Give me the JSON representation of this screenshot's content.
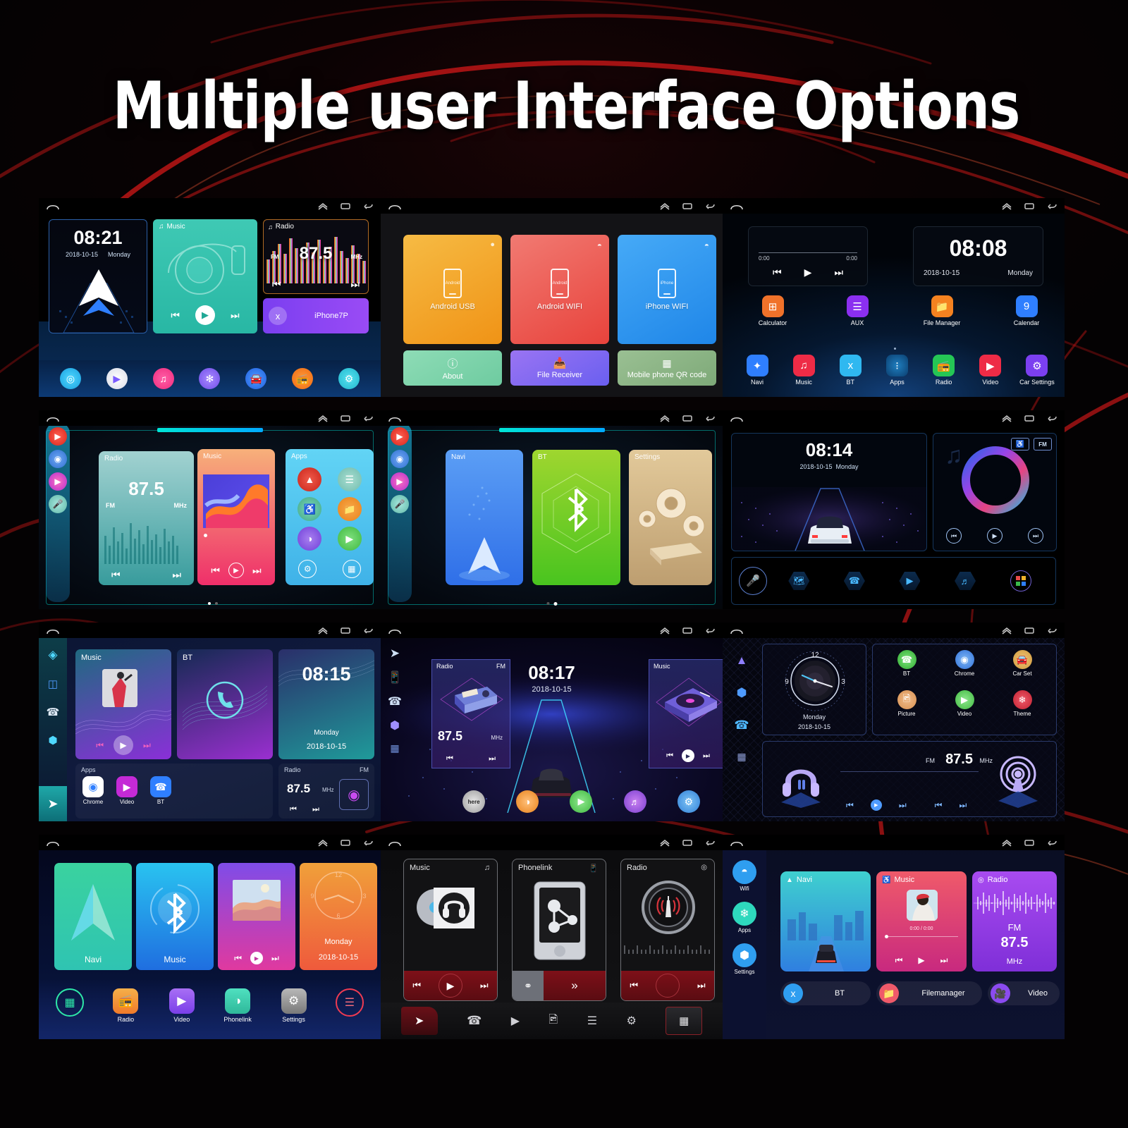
{
  "page": {
    "title": "Multiple user Interface Options"
  },
  "statusbar": {
    "home_icon": "home-icon",
    "up_icon": "chevron-up-icon",
    "recents_icon": "recents-icon",
    "back_icon": "back-icon"
  },
  "common": {
    "date": "2018-10-15",
    "day": "Monday",
    "fm": "FM",
    "mhz": "MHz",
    "freq": "87.5",
    "prev": "⏮",
    "play": "▶",
    "next": "⏭"
  },
  "screens": [
    {
      "id": "screen-1-ui-classic-cards",
      "clock": "08:21",
      "date": "2018-10-15",
      "day": "Monday",
      "music_title": "Music",
      "radio_title": "Radio",
      "radio_freq": "87.5",
      "radio_fm": "FM",
      "radio_mhz": "MHz",
      "bt_device": "iPhone7P",
      "dock": [
        {
          "label": "Navi",
          "icon": "location-pin-icon",
          "color": "#2ec6f0"
        },
        {
          "label": "Video",
          "icon": "play-icon",
          "color": "#e9eef5"
        },
        {
          "label": "Music",
          "icon": "music-note-icon",
          "color": "#ff3a8c"
        },
        {
          "label": "Theme",
          "icon": "sun-burst-icon",
          "color": "#7b5bff"
        },
        {
          "label": "Car Set",
          "icon": "car-icon",
          "color": "#2f7fff"
        },
        {
          "label": "Radio",
          "icon": "radio-icon",
          "color": "#ff7a1a"
        },
        {
          "label": "Settings",
          "icon": "gear-icon",
          "color": "#33d1e0"
        }
      ]
    },
    {
      "id": "screen-2-phonelink",
      "tiles": [
        {
          "label": "Android USB",
          "icon": "android-phone-icon",
          "badge": "usb-icon",
          "color": "#f6b73c",
          "color2": "#f59a22",
          "inner": "Android"
        },
        {
          "label": "Android WIFI",
          "icon": "android-phone-icon",
          "badge": "wifi-icon",
          "color": "#f06a6a",
          "color2": "#e8413e",
          "inner": "Android"
        },
        {
          "label": "iPhone WIFI",
          "icon": "iphone-icon",
          "badge": "wifi-icon",
          "color": "#42a5f5",
          "color2": "#1e88e5",
          "inner": "iPhone"
        }
      ],
      "tiles2": [
        {
          "label": "About",
          "icon": "info-icon",
          "color": "#7fd6ae",
          "color2": "#6fcfa6"
        },
        {
          "label": "File Receiver",
          "icon": "inbox-download-icon",
          "color": "#8f6bf0",
          "color2": "#6f63ef"
        },
        {
          "label": "Mobile phone QR code",
          "icon": "qr-code-icon",
          "color": "#8fb58a",
          "color2": "#7ea978"
        }
      ]
    },
    {
      "id": "screen-3-stock-android",
      "clock": "08:08",
      "date": "2018-10-15",
      "day": "Monday",
      "elapsed": "0:00",
      "duration": "0:00",
      "apps_row1": [
        {
          "label": "Calculator",
          "icon": "calculator-icon",
          "color": "#f0722a"
        },
        {
          "label": "AUX",
          "icon": "equalizer-icon",
          "color": "#8b2ff0"
        },
        {
          "label": "File Manager",
          "icon": "folder-icon",
          "color": "#f58220"
        },
        {
          "label": "Calendar",
          "icon": "calendar-icon",
          "color": "#2f7fff"
        }
      ],
      "apps_row2": [
        {
          "label": "Navi",
          "icon": "compass-icon",
          "color": "#2f7fff"
        },
        {
          "label": "Music",
          "icon": "music-note-icon",
          "color": "#ee2b46"
        },
        {
          "label": "BT",
          "icon": "bluetooth-icon",
          "color": "#2fb8f0"
        },
        {
          "label": "Apps",
          "icon": "app-grid-icon",
          "color": "#0e6fb0"
        },
        {
          "label": "Radio",
          "icon": "radio-icon",
          "color": "#25c655"
        },
        {
          "label": "Video",
          "icon": "play-circle-icon",
          "color": "#ee2b46"
        },
        {
          "label": "Car Settings",
          "icon": "gear-icon",
          "color": "#7b3ff0"
        }
      ]
    },
    {
      "id": "screen-4-hud-cards-a",
      "cards": [
        {
          "title": "Radio",
          "kind": "radio",
          "freq": "87.5",
          "fm": "FM",
          "mhz": "MHz"
        },
        {
          "title": "Music",
          "kind": "music"
        },
        {
          "title": "Apps",
          "kind": "apps"
        }
      ],
      "rail": [
        {
          "icon": "youtube-icon",
          "color": "#ff3b30"
        },
        {
          "icon": "chrome-icon",
          "color": "#4285f4"
        },
        {
          "icon": "play-store-icon",
          "color": "#e91e8c"
        },
        {
          "icon": "microphone-icon",
          "color": "#7ed0c0"
        }
      ],
      "app_icons": [
        {
          "icon": "navi-icon",
          "color": "#e13b3b"
        },
        {
          "icon": "equalizer-icon",
          "color": "#7fc4b8"
        },
        {
          "icon": "headset-icon",
          "color": "#63c6a8"
        },
        {
          "icon": "folder-icon",
          "color": "#f0922a"
        },
        {
          "icon": "browser-icon",
          "color": "#8b5bd6"
        },
        {
          "icon": "video-icon",
          "color": "#54c45a"
        },
        {
          "icon": "gear-icon",
          "color": "#ffffff"
        },
        {
          "icon": "app-grid-icon",
          "color": "#ffffff"
        }
      ]
    },
    {
      "id": "screen-5-hud-cards-b",
      "cards": [
        {
          "title": "Navi",
          "kind": "navi"
        },
        {
          "title": "BT",
          "kind": "bt"
        },
        {
          "title": "Settings",
          "kind": "settings"
        }
      ],
      "rail": [
        {
          "icon": "youtube-icon",
          "color": "#ff3b30"
        },
        {
          "icon": "chrome-icon",
          "color": "#4285f4"
        },
        {
          "icon": "play-store-icon",
          "color": "#e91e8c"
        },
        {
          "icon": "microphone-icon",
          "color": "#7ed0c0"
        }
      ]
    },
    {
      "id": "screen-6-car-dashboard",
      "clock": "08:14",
      "date": "2018-10-15",
      "day": "Monday",
      "fm_badge": "FM",
      "headset_badge": "headset-icon",
      "dock": [
        {
          "icon": "microphone-icon",
          "label": "Voice"
        },
        {
          "icon": "map-icon",
          "label": "Map"
        },
        {
          "icon": "phone-bt-icon",
          "label": "BT Phone"
        },
        {
          "icon": "video-icon",
          "label": "Video"
        },
        {
          "icon": "music-disc-icon",
          "label": "Music"
        },
        {
          "icon": "app-grid-icon",
          "label": "Apps"
        }
      ]
    },
    {
      "id": "screen-7-teal-cards",
      "music_title": "Music",
      "bt_title": "BT",
      "clock": "08:15",
      "day": "Monday",
      "date": "2018-10-15",
      "apps_title": "Apps",
      "apps": [
        {
          "label": "Chrome",
          "icon": "chrome-icon",
          "color": "#ffffff"
        },
        {
          "label": "Video",
          "icon": "video-icon",
          "color": "#c42ad6"
        },
        {
          "label": "BT",
          "icon": "phone-bt-icon",
          "color": "#2f7fff"
        }
      ],
      "radio_title": "Radio",
      "radio_fm": "FM",
      "radio_freq": "87.5",
      "radio_mhz": "MHz",
      "rail": [
        {
          "icon": "cube-3d-icon"
        },
        {
          "icon": "screen-cast-icon"
        },
        {
          "icon": "phone-bt-icon"
        },
        {
          "icon": "hexagon-settings-icon"
        },
        {
          "icon": "navi-paperplane-icon"
        }
      ]
    },
    {
      "id": "screen-8-road-theme",
      "clock": "08:17",
      "date": "2018-10-15",
      "radio_title": "Radio",
      "radio_fm": "FM",
      "radio_freq": "87.5",
      "radio_mhz": "MHz",
      "music_title": "Music",
      "rail": [
        {
          "icon": "navi-paperplane-icon"
        },
        {
          "icon": "phonelink-icon"
        },
        {
          "icon": "phone-bt-icon"
        },
        {
          "icon": "hexagon-settings-icon"
        },
        {
          "icon": "app-grid-icon"
        }
      ],
      "dock": [
        {
          "icon": "here-maps-icon",
          "color": "#d8d8d8"
        },
        {
          "icon": "browser-icon",
          "color": "#f0962a"
        },
        {
          "icon": "video-icon",
          "color": "#4ec94e"
        },
        {
          "icon": "music-disc-icon",
          "color": "#9b4bd6"
        },
        {
          "icon": "gear-icon",
          "color": "#3b9ae8"
        }
      ]
    },
    {
      "id": "screen-9-analog-clock",
      "day": "Monday",
      "date": "2018-10-15",
      "clock_numbers": [
        "12",
        "3",
        "9"
      ],
      "apps": [
        {
          "label": "BT",
          "icon": "phone-bt-icon",
          "color": "#4ec94e"
        },
        {
          "label": "Chrome",
          "icon": "chrome-icon",
          "color": "#4285f4"
        },
        {
          "label": "Car Set",
          "icon": "car-icon",
          "color": "#e0a040"
        },
        {
          "label": "Picture",
          "icon": "picture-icon",
          "color": "#e09a50"
        },
        {
          "label": "Video",
          "icon": "video-icon",
          "color": "#4ec94e"
        },
        {
          "label": "Theme",
          "icon": "theme-icon",
          "color": "#e0334a"
        }
      ],
      "radio_fm": "FM",
      "radio_freq": "87.5",
      "radio_mhz": "MHz",
      "rail": [
        {
          "icon": "navi-triangle-icon"
        },
        {
          "icon": "hexagon-settings-icon"
        },
        {
          "icon": "phone-icon"
        },
        {
          "icon": "app-grid-icon"
        }
      ]
    },
    {
      "id": "screen-10-gradient-tiles",
      "tiles": [
        {
          "label": "Navi",
          "kind": "navi",
          "c1": "#3ad29f",
          "c2": "#2fc4b2"
        },
        {
          "label": "Music",
          "kind": "bt",
          "c1": "#29c3f0",
          "c2": "#1f6ee0"
        },
        {
          "label": "",
          "kind": "photo",
          "c1": "#b44de8",
          "c2": "#e0399f"
        },
        {
          "label": "",
          "kind": "clock",
          "c1": "#f0a03a",
          "c2": "#ef5a3c"
        }
      ],
      "tile_clock_day": "Monday",
      "tile_clock_date": "2018-10-15",
      "dock": [
        {
          "label": "",
          "icon": "app-grid-icon",
          "color": "#2ee8a8"
        },
        {
          "label": "Radio",
          "icon": "radio-icon",
          "color": "#f0902a"
        },
        {
          "label": "Video",
          "icon": "video-icon",
          "color": "#8b4bf0"
        },
        {
          "label": "Phonelink",
          "icon": "browser-icon",
          "color": "#3ad29f"
        },
        {
          "label": "Settings",
          "icon": "gear-icon",
          "color": "#8a8a8a"
        },
        {
          "label": "",
          "icon": "equalizer-icon",
          "color": "#ef3b52"
        }
      ]
    },
    {
      "id": "screen-11-dark-red-theme",
      "cards": [
        {
          "title": "Music",
          "badge": "music-note-icon",
          "kind": "music"
        },
        {
          "title": "Phonelink",
          "badge": "phone-small-icon",
          "kind": "phonelink"
        },
        {
          "title": "Radio",
          "badge": "signal-icon",
          "kind": "radio"
        }
      ],
      "dock": [
        {
          "icon": "navi-paperplane-icon"
        },
        {
          "icon": "phone-icon"
        },
        {
          "icon": "video-icon"
        },
        {
          "icon": "picture-icon"
        },
        {
          "icon": "equalizer-icon"
        },
        {
          "icon": "gear-icon"
        },
        {
          "icon": "app-grid-icon"
        }
      ]
    },
    {
      "id": "screen-12-blue-cards",
      "rail": [
        {
          "label": "Wifi",
          "icon": "wifi-icon",
          "color": "#2f9ef0"
        },
        {
          "label": "Apps",
          "icon": "clover-apps-icon",
          "color": "#2ed8bd"
        },
        {
          "label": "Settings",
          "icon": "hexagon-settings-icon",
          "color": "#2f9ef0"
        }
      ],
      "tiles": [
        {
          "title": "Navi",
          "icon": "navi-icon",
          "kind": "navi"
        },
        {
          "title": "Music",
          "icon": "headset-icon",
          "kind": "music",
          "progress": "0:00 / 0:00"
        },
        {
          "title": "Radio",
          "icon": "signal-icon",
          "kind": "radio",
          "fm": "FM",
          "freq": "87.5",
          "mhz": "MHz"
        }
      ],
      "pills": [
        {
          "label": "BT",
          "icon": "bluetooth-icon",
          "color": "#2f9ef0"
        },
        {
          "label": "Filemanager",
          "icon": "folder-check-icon",
          "color": "#ef5a6a"
        },
        {
          "label": "Video",
          "icon": "video-cam-icon",
          "color": "#8b4bf0"
        }
      ]
    }
  ]
}
